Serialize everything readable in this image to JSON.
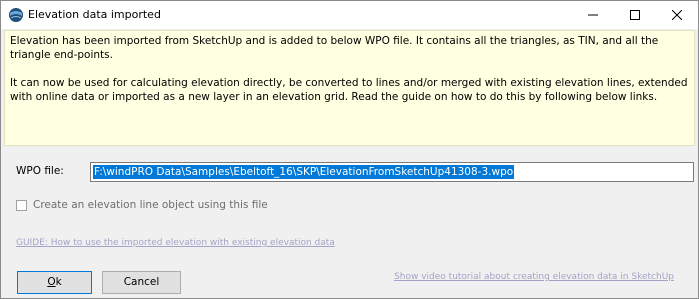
{
  "window": {
    "title": "Elevation data imported",
    "app_icon": "windpro-globe-icon",
    "controls": [
      "minimize-icon",
      "maximize-icon",
      "close-icon"
    ]
  },
  "info": {
    "paragraph1": "Elevation has been imported from SketchUp and is added to below WPO file. It contains all the triangles, as TIN, and all the triangle end-points.",
    "paragraph2": "It can now be used for calculating elevation directly, be converted to lines and/or merged with existing elevation lines, extended with online data or imported as a new layer in an elevation grid. Read the guide on how to do this by following below links."
  },
  "wpo": {
    "label": "WPO file:",
    "value": "F:\\windPRO Data\\Samples\\Ebeltoft_16\\SKP\\ElevationFromSketchUp41308-3.wpo"
  },
  "checkbox": {
    "label": "Create an elevation line object using this file",
    "checked": false
  },
  "links": {
    "guide": "GUIDE: How to use the imported elevation with existing elevation data",
    "video": "Show video tutorial about creating elevation data in SketchUp"
  },
  "buttons": {
    "ok_mnemonic": "O",
    "ok_rest": "k",
    "cancel": "Cancel"
  },
  "colors": {
    "info_background": "#ffffe1",
    "selection": "#0078d7",
    "link_disabled": "#a3a3c8"
  }
}
